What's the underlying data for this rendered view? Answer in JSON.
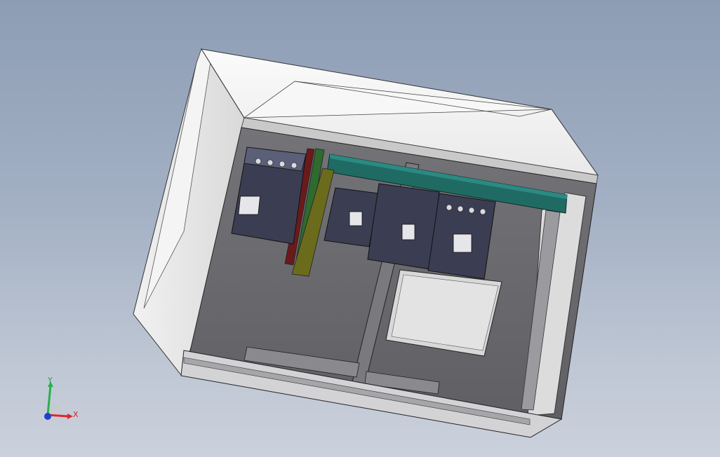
{
  "viewport": {
    "background_top": "#8d9db4",
    "background_bottom": "#cbd1dc"
  },
  "model": {
    "enclosure_color": "#e6e6e6",
    "panel_color": "#6f6f72",
    "rail_color": "#1f6b64",
    "busbar_colors": [
      "#6a1a1a",
      "#2f6a2f",
      "#6b6b1c"
    ],
    "breaker_color": "#3b3e52"
  },
  "triad": {
    "x_label": "X",
    "y_label": "Y",
    "x_color": "#e0262a",
    "y_color": "#29b04a",
    "z_color": "#1f3fd0"
  }
}
